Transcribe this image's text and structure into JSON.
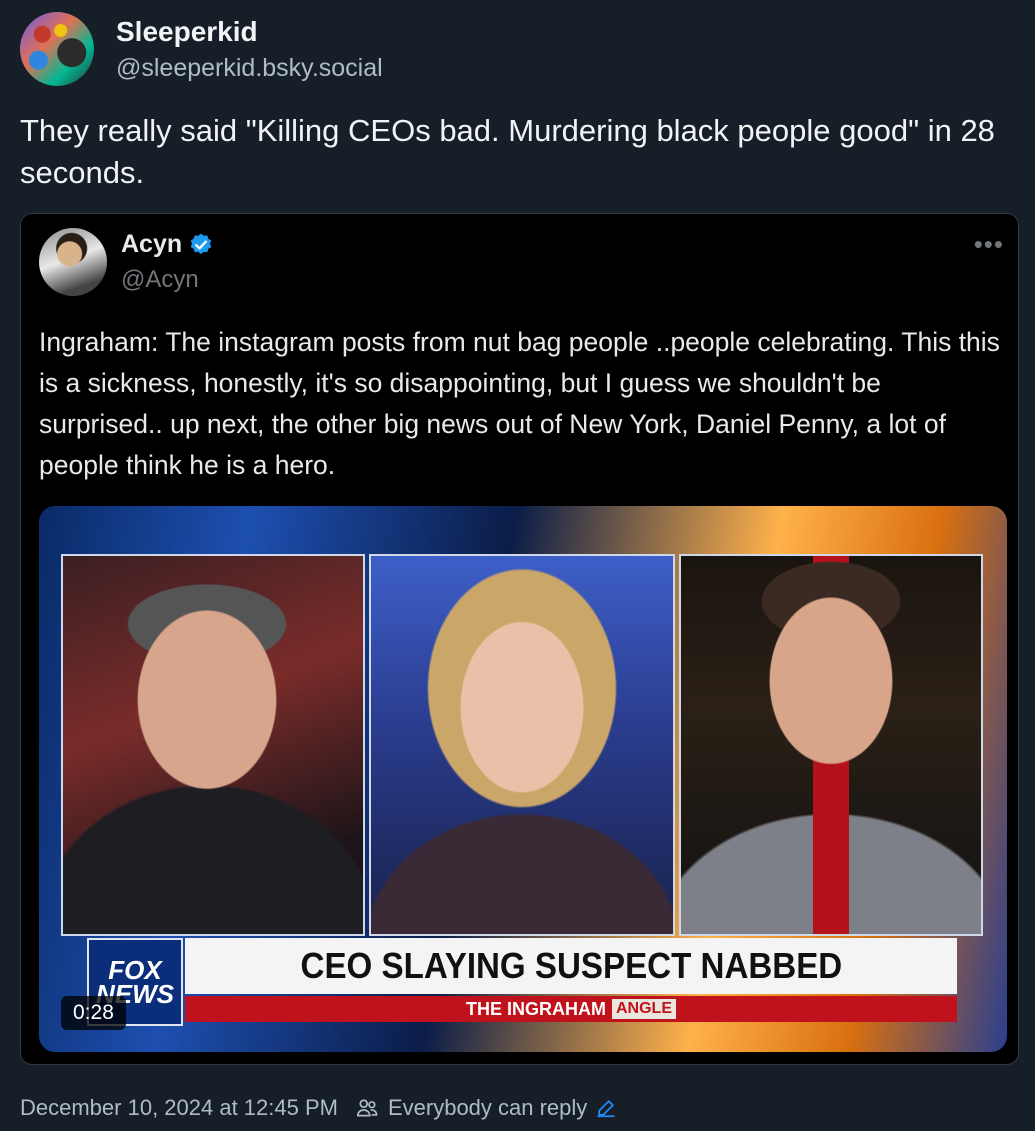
{
  "author": {
    "display_name": "Sleeperkid",
    "handle": "@sleeperkid.bsky.social"
  },
  "post": {
    "text": "They really said \"Killing CEOs bad. Murdering black people good\" in 28 seconds."
  },
  "embed": {
    "display_name": "Acyn",
    "handle": "@Acyn",
    "more_label": "•••",
    "text": "Ingraham: The instagram posts from nut bag people ..people celebrating. This this is a sickness, honestly, it's so disappointing, but I guess we shouldn't be surprised.. up next, the other big news out of New York, Daniel Penny, a lot of people think he is a hero.",
    "video": {
      "duration": "0:28",
      "logo_line1": "FOX",
      "logo_line2": "NEWS",
      "headline": "CEO SLAYING SUSPECT NABBED",
      "show_prefix": "THE INGRAHAM",
      "show_suffix": "ANGLE"
    }
  },
  "footer": {
    "timestamp": "December 10, 2024 at 12:45 PM",
    "reply_setting": "Everybody can reply"
  },
  "colors": {
    "background": "#161e27",
    "accent": "#208bfe",
    "verified": "#1d9bf0",
    "fox_red": "#c0121c"
  }
}
